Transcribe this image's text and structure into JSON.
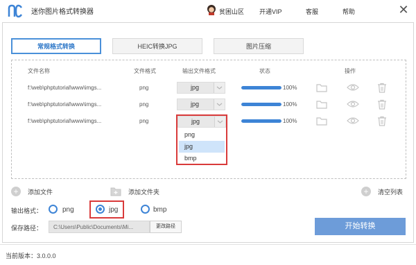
{
  "app": {
    "title": "迷你图片格式转换器",
    "user_name": "贫困山区",
    "links": [
      "开通VIP",
      "客服",
      "帮助"
    ],
    "close": "✕"
  },
  "tabs": [
    {
      "label": "常规格式转换",
      "active": true
    },
    {
      "label": "HEIC转换JPG",
      "active": false
    },
    {
      "label": "图片压缩",
      "active": false
    }
  ],
  "table": {
    "headers": [
      "文件名称",
      "文件格式",
      "输出文件格式",
      "状态",
      "操作"
    ],
    "rows": [
      {
        "file": "f:\\web\\phptutorial\\www\\imgs...",
        "format": "png",
        "output": "jpg",
        "progress": 100,
        "status": "100%"
      },
      {
        "file": "f:\\web\\phptutorial\\www\\imgs...",
        "format": "png",
        "output": "jpg",
        "progress": 100,
        "status": "100%"
      },
      {
        "file": "f:\\web\\phptutorial\\www\\imgs...",
        "format": "png",
        "output": "jpg",
        "progress": 100,
        "status": "100%"
      }
    ],
    "dropdown_options": [
      "png",
      "jpg",
      "bmp"
    ],
    "dropdown_selected": "jpg"
  },
  "actions": {
    "add_file": "添加文件",
    "add_folder": "添加文件夹",
    "clear_list": "清空列表"
  },
  "output_format": {
    "label": "输出格式：",
    "options": [
      "png",
      "jpg",
      "bmp"
    ],
    "selected": "jpg"
  },
  "save_path": {
    "label": "保存路径：",
    "value": "C:\\Users\\Public\\Documents\\Mi...",
    "change_button": "更改路径"
  },
  "start_button": "开始转换",
  "footer": {
    "version": "当前版本：3.0.0.0"
  },
  "colors": {
    "accent": "#3d84d6",
    "start_button": "#6d9cd9",
    "highlight": "#d93a3a"
  }
}
